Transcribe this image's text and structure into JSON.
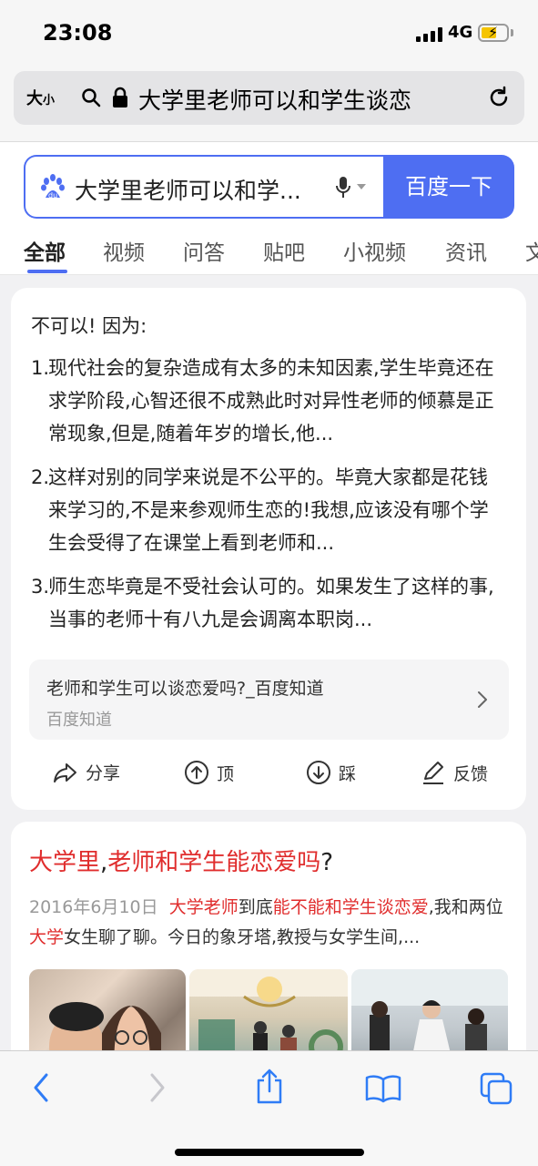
{
  "status_bar": {
    "time": "23:08",
    "network": "4G"
  },
  "address_bar": {
    "text_size_label": "大",
    "text_size_small": "小",
    "url_text": "大学里老师可以和学生谈恋"
  },
  "search": {
    "query": "大学里老师可以和学...",
    "button_label": "百度一下",
    "brand_color": "#4e6ef2"
  },
  "tabs": [
    {
      "label": "全部",
      "active": true
    },
    {
      "label": "视频"
    },
    {
      "label": "问答"
    },
    {
      "label": "贴吧"
    },
    {
      "label": "小视频"
    },
    {
      "label": "资讯"
    },
    {
      "label": "文"
    }
  ],
  "answer_card": {
    "intro": "不可以! 因为:",
    "items": [
      {
        "num": "1.",
        "text": "现代社会的复杂造成有太多的未知因素,学生毕竟还在求学阶段,心智还很不成熟此时对异性老师的倾慕是正常现象,但是,随着年岁的增长,他..."
      },
      {
        "num": "2.",
        "text": "这样对别的同学来说是不公平的。毕竟大家都是花钱来学习的,不是来参观师生恋的!我想,应该没有哪个学生会受得了在课堂上看到老师和..."
      },
      {
        "num": "3.",
        "text": "师生恋毕竟是不受社会认可的。如果发生了这样的事,当事的老师十有八九是会调离本职岗..."
      }
    ],
    "source": {
      "title": "老师和学生可以谈恋爱吗?_百度知道",
      "site": "百度知道"
    },
    "actions": {
      "share": "分享",
      "up": "顶",
      "down": "踩",
      "feedback": "反馈"
    }
  },
  "result_card": {
    "title_red_1": "大学里",
    "title_black_1": ",",
    "title_red_2": "老师和学生能恋爱吗",
    "title_black_2": "?",
    "date": "2016年6月10日",
    "snippet_red_1": "大学老师",
    "snippet_black_1": "到底",
    "snippet_red_2": "能不能和学生谈恋爱",
    "snippet_black_2": ",我和两位",
    "snippet_red_3": "大学",
    "snippet_black_3": "女生聊了聊。今日的象牙塔,教授与女学生间,..."
  },
  "colors": {
    "accent": "#4e6ef2",
    "highlight": "#e02d2d",
    "battery": "#f5c400"
  }
}
